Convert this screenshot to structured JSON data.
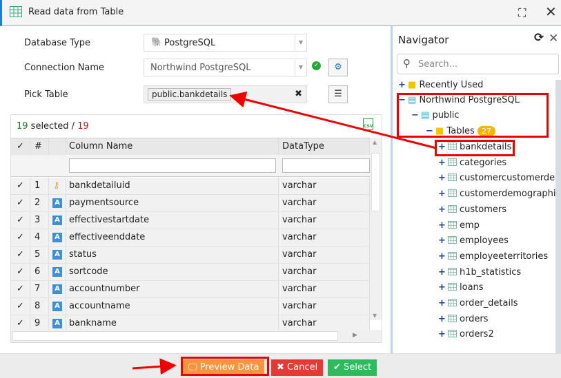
{
  "window": {
    "title": "Read data from Table"
  },
  "form": {
    "database_type_label": "Database Type",
    "database_type_value": "PostgreSQL",
    "connection_name_label": "Connection Name",
    "connection_name_value": "Northwind PostgreSQL",
    "pick_table_label": "Pick Table",
    "pick_table_value": "public.bankdetails"
  },
  "grid": {
    "selected_count": "19",
    "selected_text": " selected / ",
    "total_count": "19",
    "headers": {
      "check": "✓",
      "num": "#",
      "name": "Column Name",
      "type": "DataType"
    },
    "rows": [
      {
        "n": "1",
        "icon": "key",
        "name": "bankdetailuid",
        "type": "varchar"
      },
      {
        "n": "2",
        "icon": "A",
        "name": "paymentsource",
        "type": "varchar"
      },
      {
        "n": "3",
        "icon": "A",
        "name": "effectivestartdate",
        "type": "varchar"
      },
      {
        "n": "4",
        "icon": "A",
        "name": "effectiveenddate",
        "type": "varchar"
      },
      {
        "n": "5",
        "icon": "A",
        "name": "status",
        "type": "varchar"
      },
      {
        "n": "6",
        "icon": "A",
        "name": "sortcode",
        "type": "varchar"
      },
      {
        "n": "7",
        "icon": "A",
        "name": "accountnumber",
        "type": "varchar"
      },
      {
        "n": "8",
        "icon": "A",
        "name": "accountname",
        "type": "varchar"
      },
      {
        "n": "9",
        "icon": "A",
        "name": "bankname",
        "type": "varchar"
      }
    ]
  },
  "footer": {
    "preview": "Preview Data",
    "cancel": "Cancel",
    "select": "Select"
  },
  "navigator": {
    "title": "Navigator",
    "search_placeholder": "Search...",
    "recently_used": "Recently Used",
    "connection": "Northwind PostgreSQL",
    "schema": "public",
    "tables_label": "Tables",
    "tables_count": "27",
    "tables": [
      "bankdetails",
      "categories",
      "customercustomerdemo",
      "customerdemographics",
      "customers",
      "emp",
      "employees",
      "employeeterritories",
      "h1b_statistics",
      "loans",
      "order_details",
      "orders",
      "orders2"
    ]
  },
  "colors": {
    "accent": "#1e7fd0",
    "preview": "#f7953e",
    "cancel": "#e53935",
    "select": "#2dbb5d",
    "highlight": "#e00000"
  }
}
